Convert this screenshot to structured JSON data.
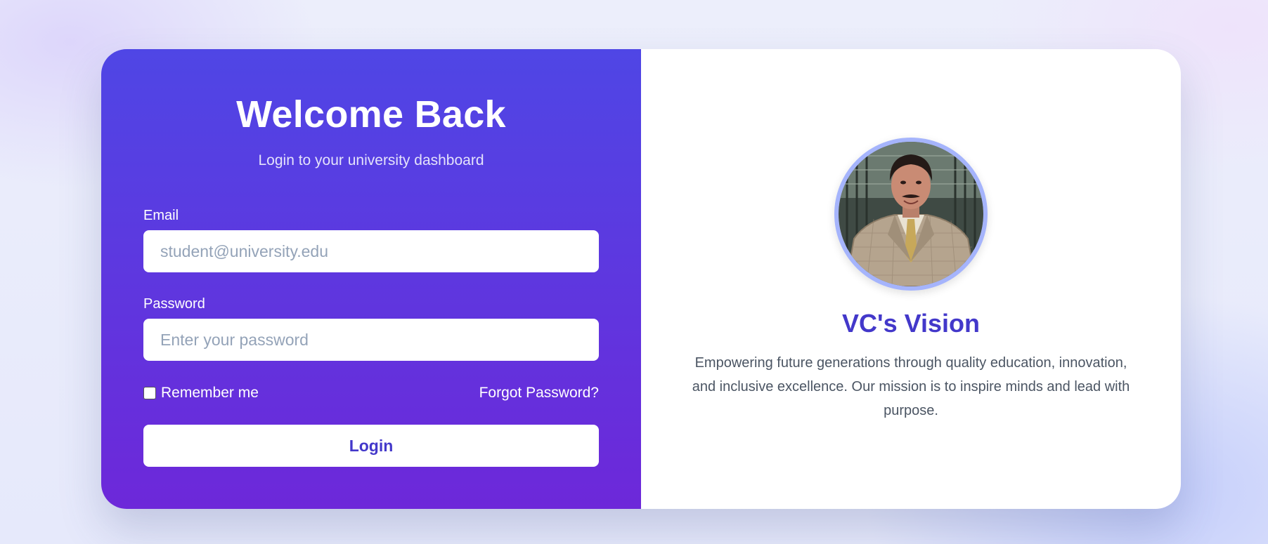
{
  "login": {
    "title": "Welcome Back",
    "subtitle": "Login to your university dashboard",
    "email_label": "Email",
    "email_placeholder": "student@university.edu",
    "password_label": "Password",
    "password_placeholder": "Enter your password",
    "remember_label": "Remember me",
    "forgot_label": "Forgot Password?",
    "button_label": "Login"
  },
  "vision": {
    "title": "VC's Vision",
    "text": "Empowering future generations through quality education, innovation, and inclusive excellence. Our mission is to inspire minds and lead with purpose."
  },
  "colors": {
    "gradient_start": "#4f46e5",
    "gradient_end": "#6d28d9",
    "accent": "#4338ca",
    "avatar_ring": "#a5b4fc"
  }
}
